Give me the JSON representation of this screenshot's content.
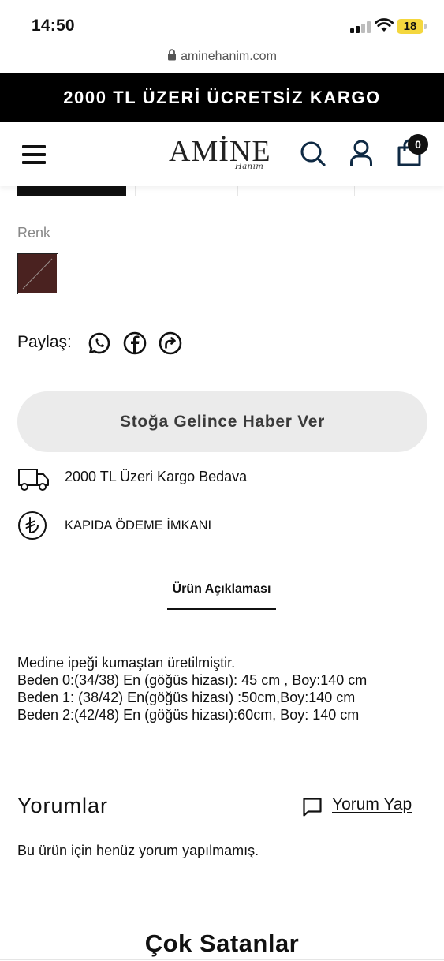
{
  "status_bar": {
    "time": "14:50",
    "battery": "18"
  },
  "browser": {
    "url": "aminehanim.com"
  },
  "announcement": {
    "text": "2000 TL ÜZERİ ÜCRETSİZ KARGO"
  },
  "header": {
    "logo_text": "AMİNE",
    "logo_subtext": "Hanım",
    "cart_count": "0"
  },
  "product": {
    "color_label": "Renk",
    "swatch_color": "#4a2220",
    "share_label": "Paylaş:",
    "notify_button": "Stoğa Gelince Haber Ver"
  },
  "features": [
    {
      "icon": "truck-icon",
      "text": "2000 TL Üzeri Kargo Bedava"
    },
    {
      "icon": "lira-icon",
      "text": "KAPIDA ÖDEME İMKANI"
    }
  ],
  "tabs": {
    "description_tab": "Ürün Açıklaması"
  },
  "description": {
    "lines": [
      "Medine ipeği kumaştan üretilmiştir.",
      "Beden 0:(34/38) En (göğüs hizası): 45 cm , Boy:140 cm",
      "Beden 1: (38/42) En(göğüs hizası) :50cm,Boy:140 cm",
      "Beden 2:(42/48) En (göğüs hizası):60cm, Boy: 140 cm"
    ]
  },
  "reviews": {
    "title": "Yorumlar",
    "write_review": "Yorum Yap",
    "empty_text": "Bu ürün için henüz yorum yapılmamış."
  },
  "best_sellers": {
    "title": "Çok Satanlar"
  },
  "colors": {
    "brand_dark": "#111111",
    "button_bg": "#ebebeb",
    "battery": "#f4d73e"
  }
}
